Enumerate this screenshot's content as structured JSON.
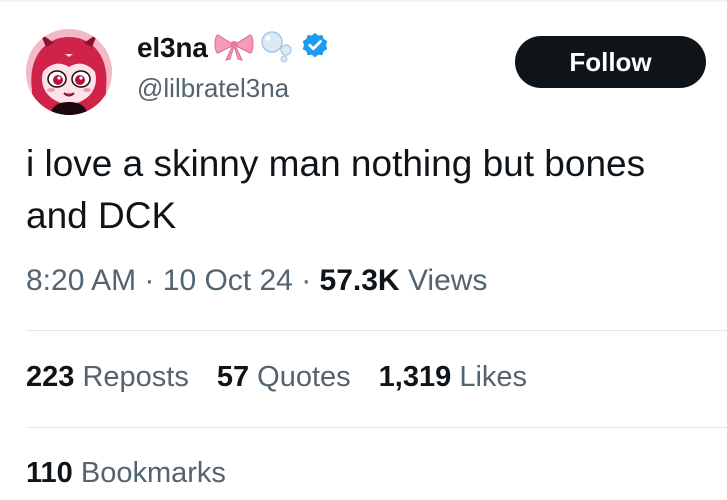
{
  "author": {
    "display_name": "el3na",
    "handle": "@lilbratel3na",
    "name_emojis": [
      "ribbon-emoji",
      "bubbles-emoji"
    ],
    "verified_badge": "verified-badge-icon",
    "verified_color": "#1d9bf0"
  },
  "follow_button": {
    "label": "Follow"
  },
  "tweet": {
    "text": "i love a skinny man nothing but bones and DCK"
  },
  "meta": {
    "time": "8:20 AM",
    "separator": "·",
    "date": "10 Oct 24",
    "views_count": "57.3K",
    "views_label": "Views"
  },
  "stats": {
    "reposts_count": "223",
    "reposts_label": "Reposts",
    "quotes_count": "57",
    "quotes_label": "Quotes",
    "likes_count": "1,319",
    "likes_label": "Likes",
    "bookmarks_count": "110",
    "bookmarks_label": "Bookmarks"
  },
  "colors": {
    "text_primary": "#0f1419",
    "text_secondary": "#536471",
    "button_bg": "#0f1419",
    "button_text": "#ffffff",
    "divider": "#e1e8ed"
  }
}
